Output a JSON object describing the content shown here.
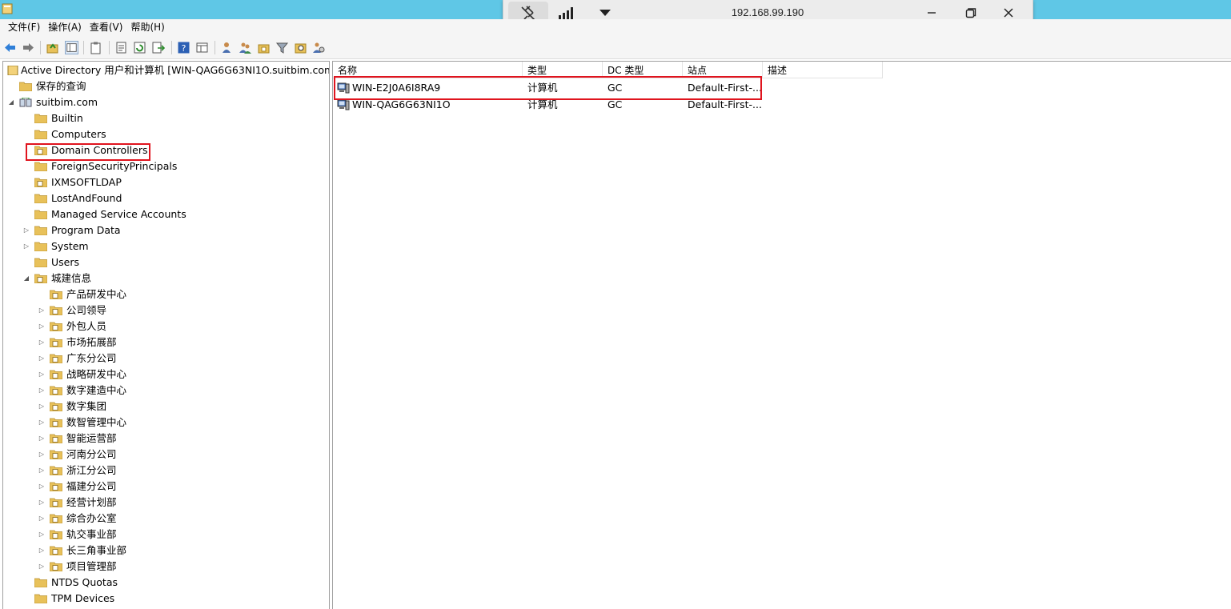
{
  "remote_bar": {
    "ip": "192.168.99.190"
  },
  "menu": [
    "文件(F)",
    "操作(A)",
    "查看(V)",
    "帮助(H)"
  ],
  "tree": {
    "root": "Active Directory 用户和计算机 [WIN-QAG6G63NI1O.suitbim.com]",
    "saved_queries": "保存的查询",
    "domain": "suitbim.com",
    "items": [
      {
        "label": "Builtin",
        "type": "folder"
      },
      {
        "label": "Computers",
        "type": "folder"
      },
      {
        "label": "Domain Controllers",
        "type": "ou"
      },
      {
        "label": "ForeignSecurityPrincipals",
        "type": "folder"
      },
      {
        "label": "IXMSOFTLDAP",
        "type": "ou"
      },
      {
        "label": "LostAndFound",
        "type": "folder"
      },
      {
        "label": "Managed Service Accounts",
        "type": "folder"
      },
      {
        "label": "Program Data",
        "type": "folder"
      },
      {
        "label": "System",
        "type": "folder"
      },
      {
        "label": "Users",
        "type": "folder"
      },
      {
        "label": "城建信息",
        "type": "ou"
      }
    ],
    "sub_items": [
      "产品研发中心",
      "公司领导",
      "外包人员",
      "市场拓展部",
      "广东分公司",
      "战略研发中心",
      "数字建造中心",
      "数字集团",
      "数智管理中心",
      "智能运营部",
      "河南分公司",
      "浙江分公司",
      "福建分公司",
      "经营计划部",
      "综合办公室",
      "轨交事业部",
      "长三角事业部",
      "项目管理部"
    ],
    "tail_items": [
      "NTDS Quotas",
      "TPM Devices"
    ]
  },
  "list": {
    "columns": [
      "名称",
      "类型",
      "DC 类型",
      "站点",
      "描述"
    ],
    "rows": [
      {
        "name": "WIN-E2J0A6I8RA9",
        "type": "计算机",
        "dc_type": "GC",
        "site": "Default-First-...",
        "desc": ""
      },
      {
        "name": "WIN-QAG6G63NI1O",
        "type": "计算机",
        "dc_type": "GC",
        "site": "Default-First-...",
        "desc": ""
      }
    ]
  },
  "colors": {
    "titlebar": "#5fc7e6",
    "highlight": "#e0141e",
    "folder": "#e8c15a"
  }
}
